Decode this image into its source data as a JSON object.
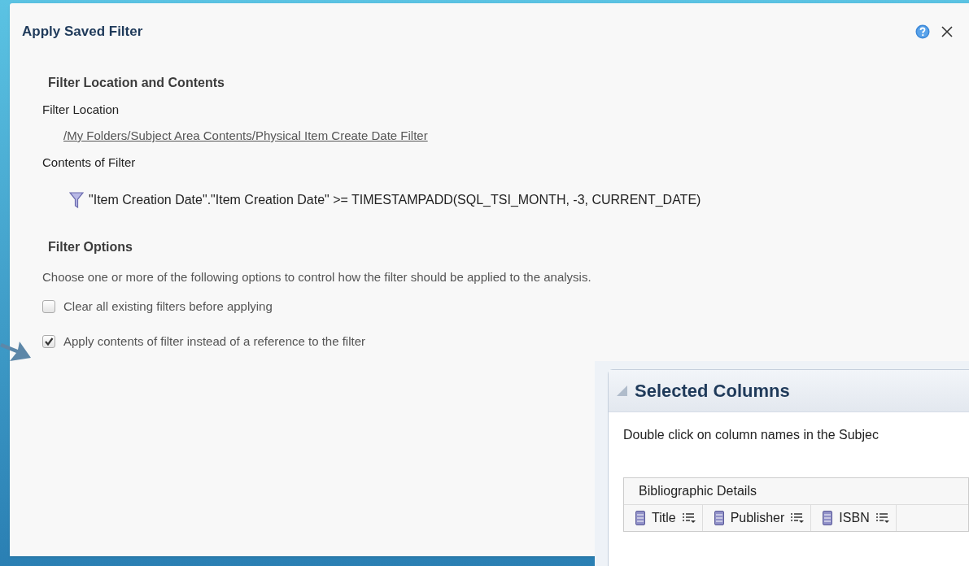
{
  "dialog": {
    "title": "Apply Saved Filter"
  },
  "location_section": {
    "heading": "Filter Location and Contents",
    "location_label": "Filter Location",
    "location_link": "/My Folders/Subject Area Contents/Physical Item Create Date Filter",
    "contents_label": "Contents of Filter",
    "expression": "\"Item Creation Date\".\"Item Creation Date\" >= TIMESTAMPADD(SQL_TSI_MONTH, -3, CURRENT_DATE)"
  },
  "options_section": {
    "heading": "Filter Options",
    "description": "Choose one or more of the following options to control how the filter should be applied to the analysis.",
    "options": [
      {
        "label": "Clear all existing filters before applying",
        "checked": false
      },
      {
        "label": "Apply contents of filter instead of a reference to the filter",
        "checked": true
      }
    ]
  },
  "inset": {
    "title": "Selected Columns",
    "instruction": "Double click on column names in the Subjec",
    "group": "Bibliographic Details",
    "columns": [
      {
        "label": "Title"
      },
      {
        "label": "Publisher"
      },
      {
        "label": "ISBN"
      }
    ]
  }
}
